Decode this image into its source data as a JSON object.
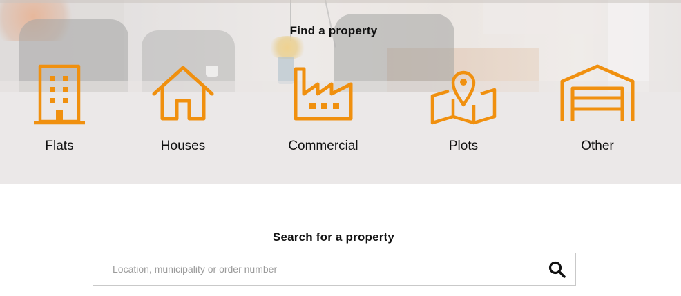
{
  "find_section": {
    "title": "Find a property",
    "categories": [
      {
        "label": "Flats",
        "icon": "building-icon"
      },
      {
        "label": "Houses",
        "icon": "house-icon"
      },
      {
        "label": "Commercial",
        "icon": "factory-icon"
      },
      {
        "label": "Plots",
        "icon": "map-pin-icon"
      },
      {
        "label": "Other",
        "icon": "garage-icon"
      }
    ]
  },
  "search_section": {
    "title": "Search for a property",
    "placeholder": "Location, municipality or order number",
    "value": "",
    "button_icon": "search-icon"
  },
  "colors": {
    "accent": "#f0900f",
    "band_background": "#ebe8e8",
    "text": "#111111"
  }
}
